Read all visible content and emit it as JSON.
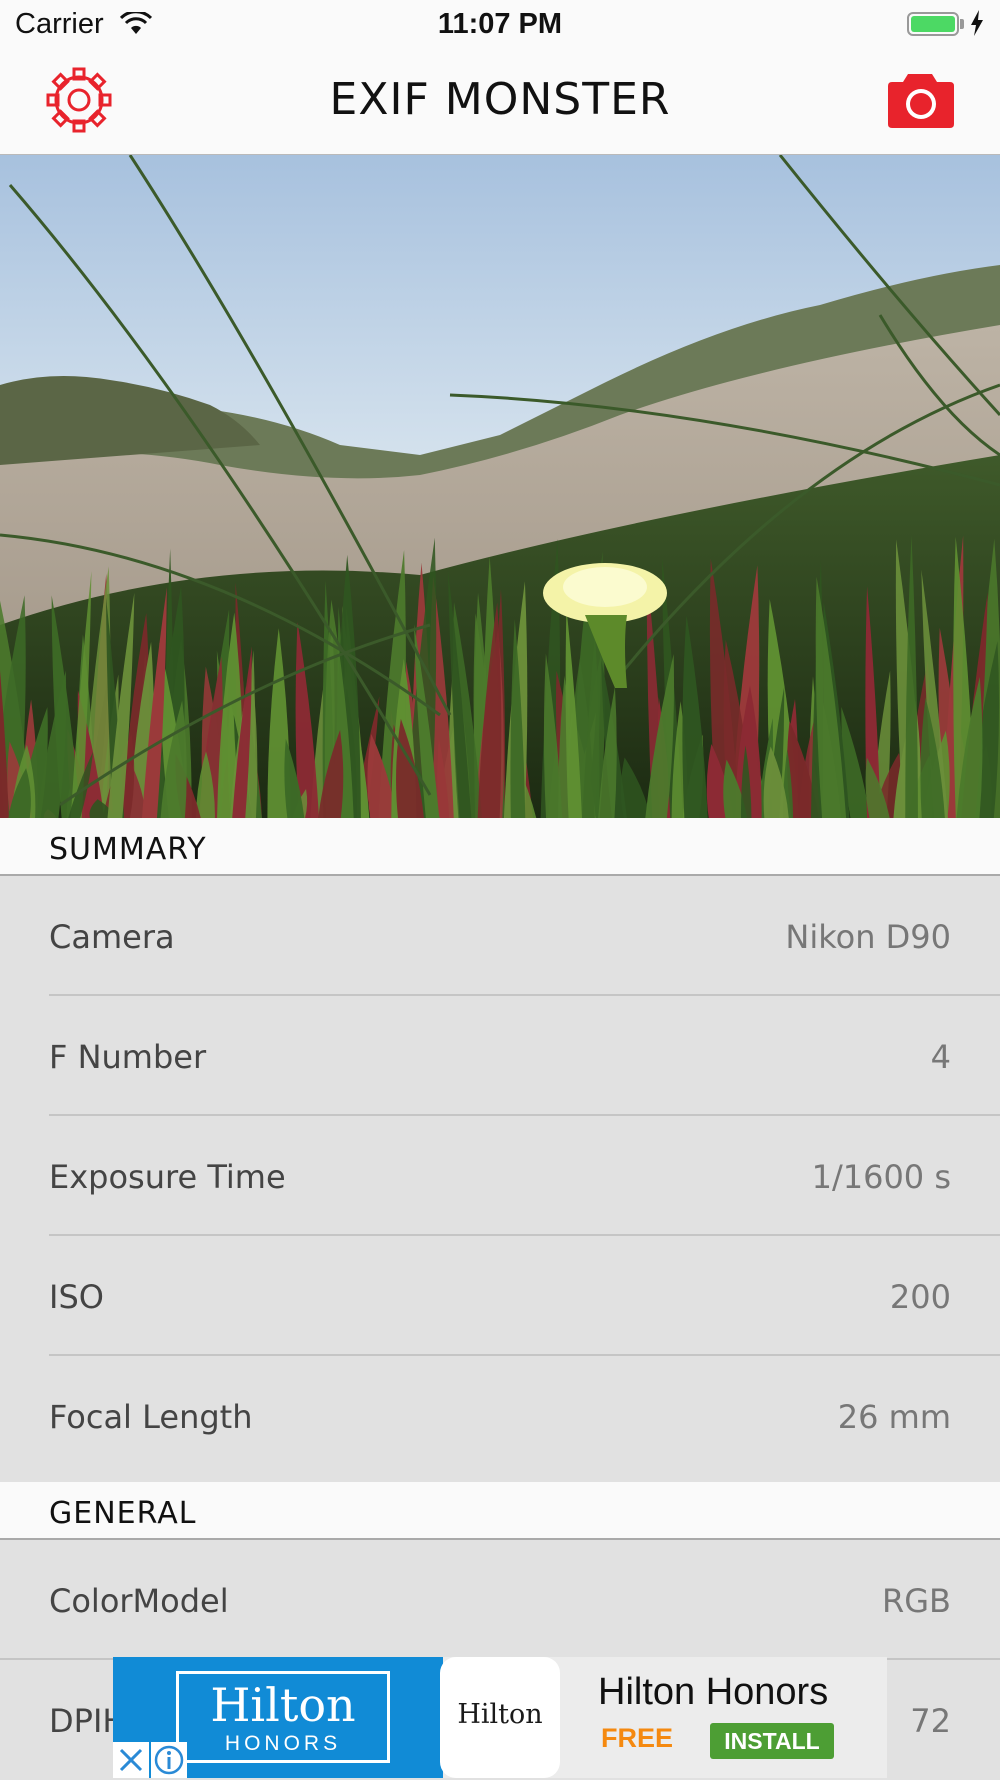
{
  "status_bar": {
    "carrier": "Carrier",
    "time": "11:07 PM",
    "battery_level": 1.0,
    "icons": [
      "wifi-icon",
      "battery-icon",
      "charging-bolt-icon"
    ]
  },
  "nav": {
    "title": "EXIF MONSTER",
    "left_icon": "gear-icon",
    "right_icon": "camera-icon",
    "accent_color": "#e8232c"
  },
  "sections": [
    {
      "title": "SUMMARY",
      "rows": [
        {
          "label": "Camera",
          "value": "Nikon D90"
        },
        {
          "label": "F Number",
          "value": "4"
        },
        {
          "label": "Exposure Time",
          "value": "1/1600 s"
        },
        {
          "label": "ISO",
          "value": "200"
        },
        {
          "label": "Focal Length",
          "value": "26 mm"
        }
      ]
    },
    {
      "title": "GENERAL",
      "rows": [
        {
          "label": "ColorModel",
          "value": "RGB"
        },
        {
          "label": "DPIH",
          "value": "72"
        }
      ]
    }
  ],
  "ad": {
    "brand_logo_word": "Hilton",
    "brand_logo_sub": "HONORS",
    "app_icon_text": "Hilton",
    "title": "Hilton Honors",
    "price": "FREE",
    "install_label": "INSTALL",
    "icons": [
      "close-icon",
      "info-icon"
    ]
  }
}
